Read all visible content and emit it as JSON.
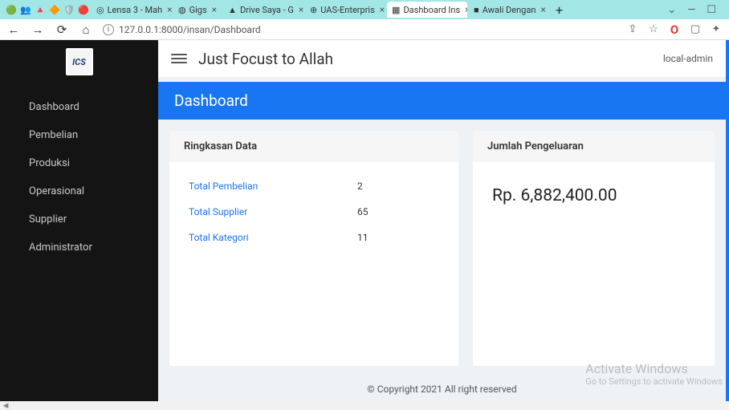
{
  "browser": {
    "tabs": [
      {
        "label": "",
        "icon": "⬤"
      },
      {
        "label": "",
        "icon": "👤"
      },
      {
        "label": "",
        "icon": "△"
      },
      {
        "label": "",
        "icon": "⬣"
      },
      {
        "label": "",
        "icon": "◆"
      },
      {
        "label": "Lensa 3 - Mah",
        "icon": "◎"
      },
      {
        "label": "Gigs",
        "icon": "◍"
      },
      {
        "label": "Drive Saya - G",
        "icon": "▲"
      },
      {
        "label": "UAS-Enterpris",
        "icon": "⊕"
      },
      {
        "label": "Dashboard Ins",
        "icon": "▦",
        "active": true
      },
      {
        "label": "Awali Dengan",
        "icon": "■"
      }
    ],
    "url": "127.0.0.1:8000/insan/Dashboard"
  },
  "sidebar": {
    "logo_text": "ICS",
    "items": [
      {
        "label": "Dashboard"
      },
      {
        "label": "Pembelian"
      },
      {
        "label": "Produksi"
      },
      {
        "label": "Operasional"
      },
      {
        "label": "Supplier"
      },
      {
        "label": "Administrator"
      }
    ]
  },
  "header": {
    "title": "Just Focust to Allah",
    "user": "local-admin"
  },
  "page": {
    "title": "Dashboard"
  },
  "summary": {
    "title": "Ringkasan Data",
    "rows": [
      {
        "label": "Total Pembelian",
        "value": "2"
      },
      {
        "label": "Total Supplier",
        "value": "65"
      },
      {
        "label": "Total Kategori",
        "value": "11"
      }
    ]
  },
  "expense": {
    "title": "Jumlah Pengeluaran",
    "value": "Rp. 6,882,400.00"
  },
  "footer": {
    "text": "© Copyright 2021 All right reserved"
  },
  "watermark": {
    "line1": "Activate Windows",
    "line2": "Go to Settings to activate Windows"
  }
}
